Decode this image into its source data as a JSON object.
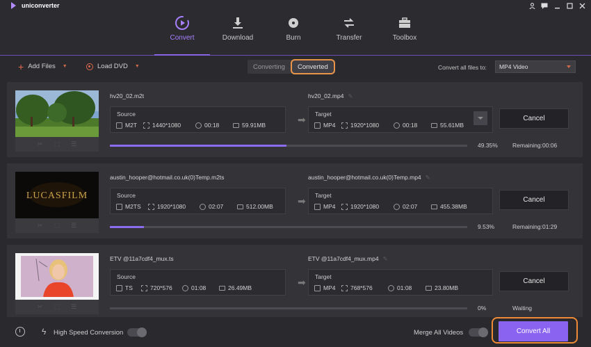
{
  "app": {
    "title": "uniconverter"
  },
  "window_controls": [
    "user-icon",
    "chat-icon",
    "minimize-icon",
    "maximize-icon",
    "close-icon"
  ],
  "nav": {
    "tabs": [
      {
        "label": "Convert",
        "icon": "convert-icon",
        "active": true
      },
      {
        "label": "Download",
        "icon": "download-icon",
        "active": false
      },
      {
        "label": "Burn",
        "icon": "burn-icon",
        "active": false
      },
      {
        "label": "Transfer",
        "icon": "transfer-icon",
        "active": false
      },
      {
        "label": "Toolbox",
        "icon": "toolbox-icon",
        "active": false
      }
    ]
  },
  "toolbar": {
    "add_files": "Add Files",
    "load_dvd": "Load DVD",
    "segments": {
      "converting": "Converting",
      "converted": "Converted",
      "active": "converted"
    },
    "convert_all_to_label": "Convert all files to:",
    "format_value": "MP4 Video"
  },
  "files": [
    {
      "source_name": "hv20_02.m2t",
      "target_name": "hv20_02.mp4",
      "source": {
        "label": "Source",
        "format": "M2T",
        "resolution": "1440*1080",
        "duration": "00:18",
        "size": "59.91MB"
      },
      "target": {
        "label": "Target",
        "format": "MP4",
        "resolution": "1920*1080",
        "duration": "00:18",
        "size": "55.61MB"
      },
      "cancel_label": "Cancel",
      "progress_fraction": 0.4935,
      "percent": "49.35%",
      "status": "Remaining:00:06"
    },
    {
      "source_name": "austin_hooper@hotmail.co.uk(0)Temp.m2ts",
      "target_name": "austin_hooper@hotmail.co.uk(0)Temp.mp4",
      "source": {
        "label": "Source",
        "format": "M2TS",
        "resolution": "1920*1080",
        "duration": "02:07",
        "size": "512.00MB"
      },
      "target": {
        "label": "Target",
        "format": "MP4",
        "resolution": "1920*1080",
        "duration": "02:07",
        "size": "455.38MB"
      },
      "cancel_label": "Cancel",
      "progress_fraction": 0.0953,
      "percent": "9.53%",
      "status": "Remaining:01:29"
    },
    {
      "source_name": "ETV @11a7cdf4_mux.ts",
      "target_name": "ETV @11a7cdf4_mux.mp4",
      "source": {
        "label": "Source",
        "format": "TS",
        "resolution": "720*576",
        "duration": "01:08",
        "size": "26.49MB"
      },
      "target": {
        "label": "Target",
        "format": "MP4",
        "resolution": "768*576",
        "duration": "01:08",
        "size": "23.80MB"
      },
      "cancel_label": "Cancel",
      "progress_fraction": 0,
      "percent": "0%",
      "status": "Waiting"
    }
  ],
  "bottom": {
    "high_speed_label": "High Speed Conversion",
    "merge_label": "Merge All Videos",
    "convert_all_label": "Convert All"
  },
  "colors": {
    "accent": "#8a63f1",
    "highlight": "#ef8a36",
    "orange": "#e06a4f"
  }
}
